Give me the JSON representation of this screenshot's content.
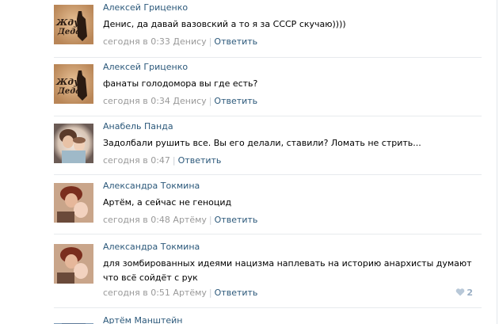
{
  "comments": [
    {
      "author": "Алексей Гриценко",
      "text": "Денис, да давай вазовский а то я за СССР скучаю))))",
      "time": "сегодня в 0:33",
      "reply_to": "Денису",
      "reply_label": "Ответить",
      "avatar_icon": "poster-avatar",
      "avatar_text": "Жду Деда"
    },
    {
      "author": "Алексей Гриценко",
      "text": "фанаты голодомора вы где есть?",
      "time": "сегодня в 0:34",
      "reply_to": "Денису",
      "reply_label": "Ответить",
      "avatar_icon": "poster-avatar",
      "avatar_text": "Жду Деда"
    },
    {
      "author": "Анабель Панда",
      "text": "Задолбали рушить все. Вы его делали, ставили? Ломать не стрить...",
      "time": "сегодня в 0:47",
      "reply_to": "",
      "reply_label": "Ответить",
      "avatar_icon": "photo-avatar"
    },
    {
      "author": "Александра Токмина",
      "text": "Артём, а сейчас не геноцид",
      "time": "сегодня в 0:48",
      "reply_to": "Артёму",
      "reply_label": "Ответить",
      "avatar_icon": "photo-avatar"
    },
    {
      "author": "Александра Токмина",
      "text": "для зомбированных идеями нацизма наплевать на историю анархисты думают что всё сойдёт с рук",
      "time": "сегодня в 0:51",
      "reply_to": "Артёму",
      "reply_label": "Ответить",
      "avatar_icon": "photo-avatar",
      "likes": "2"
    },
    {
      "author": "Артём Манштейн",
      "avatar_icon": "photo-avatar"
    }
  ],
  "colors": {
    "link": "#2b587a",
    "meta": "#999999",
    "like": "#99aec4",
    "divider": "#e7eaed"
  }
}
